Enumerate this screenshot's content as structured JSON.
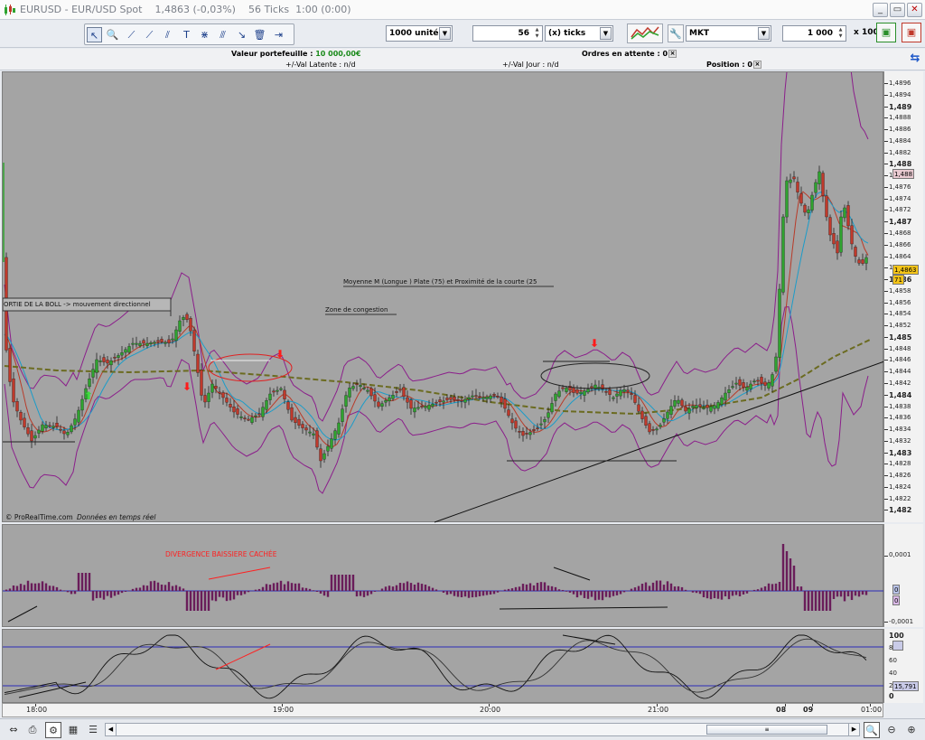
{
  "window": {
    "title": "EURUSD - EUR/USD Spot",
    "last_price": "1,4863 (-0,03%)",
    "timeframe": "56 Ticks",
    "time": "1:00 (0:00)"
  },
  "toolbar": {
    "units_select": "1000 unités",
    "period_value": "56",
    "period_unit": "(x) ticks",
    "order_type": "MKT",
    "quantity": "1 000",
    "multiplier": "x 100"
  },
  "info": {
    "portfolio_label": "Valeur portefeuille :",
    "portfolio_value": "10 000,00€",
    "pending_label": "Ordres en attente :",
    "pending_value": "0",
    "latent_label": "+/-Val Latente :",
    "latent_value": "n/d",
    "day_label": "+/-Val Jour :",
    "day_value": "n/d",
    "position_label": "Position :",
    "position_value": "0"
  },
  "annotations": {
    "bollinger_note": "ORTIE DE LA BOLL -> mouvement directionnel",
    "mm_note": "Moyenne M (Longue ) Plate (75) et Proximité de la courte (25",
    "congestion_note": "Zone de congestion",
    "divergence_note": "DIVERGENCE BAISSIERE CACHÉE",
    "source": "© ProRealTime.com",
    "realtime": "Données en temps réel"
  },
  "price_axis": {
    "ticks": [
      "1,4896",
      "1,4894",
      "1,489",
      "1,4888",
      "1,4886",
      "1,4884",
      "1,4882",
      "1,488",
      "1,4878",
      "1,4876",
      "1,4874",
      "1,4872",
      "1,487",
      "1,4868",
      "1,4866",
      "1,4864",
      "1,4862",
      "1,486",
      "1,4858",
      "1,4856",
      "1,4854",
      "1,4852",
      "1,485",
      "1,4848",
      "1,4846",
      "1,4844",
      "1,4842",
      "1,484",
      "1,4838",
      "1,4836",
      "1,4834",
      "1,4832",
      "1,483",
      "1,4828",
      "1,4826",
      "1,4824",
      "1,4822",
      "1,482"
    ],
    "last_price_tag": "1,4863",
    "high_tag": "1,488",
    "avg_tag": "71"
  },
  "osc_axis": {
    "top": "0,0001",
    "zero": "0",
    "bottom": "-0,0001"
  },
  "stoch_axis": {
    "ticks": [
      "100",
      "80",
      "60",
      "40",
      "20",
      "0"
    ],
    "value_tag": "15,791"
  },
  "time_axis": {
    "labels": [
      "18:00",
      "19:00",
      "20:00",
      "21:00",
      "08",
      "09",
      "01:00"
    ]
  },
  "colors": {
    "chart_bg": "#a4a4a4",
    "bull": "#2fa32f",
    "bear": "#c0392b",
    "bollinger": "#8b1e8b",
    "ma_short": "#1b9cc9",
    "ma_long": "#6b6b20",
    "annotation_red": "#ff2a2a"
  }
}
